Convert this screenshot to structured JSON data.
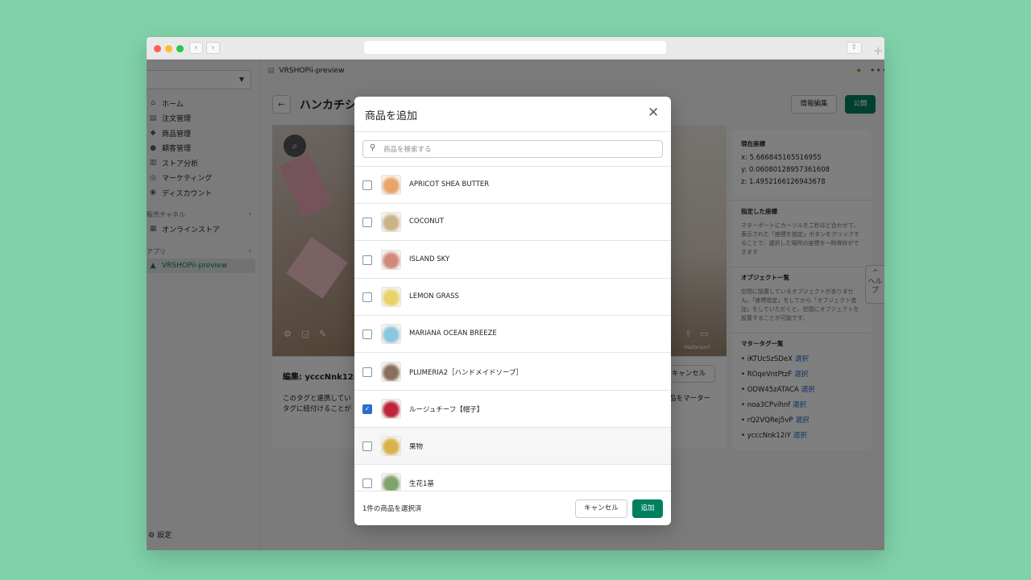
{
  "browser": {
    "back_glyph": "‹",
    "forward_glyph": "›",
    "share_glyph": "⇪",
    "new_tab_glyph": "+"
  },
  "sidebar": {
    "items": [
      {
        "label": "ホーム",
        "icon": "home-icon",
        "glyph": "⌂"
      },
      {
        "label": "注文管理",
        "icon": "orders-icon",
        "glyph": "▤"
      },
      {
        "label": "商品管理",
        "icon": "tag-icon",
        "glyph": "◆"
      },
      {
        "label": "顧客管理",
        "icon": "person-icon",
        "glyph": "●"
      },
      {
        "label": "ストア分析",
        "icon": "analytics-icon",
        "glyph": "▥"
      },
      {
        "label": "マーケティング",
        "icon": "marketing-icon",
        "glyph": "◎"
      },
      {
        "label": "ディスカウント",
        "icon": "discount-icon",
        "glyph": "◉"
      }
    ],
    "channels_label": "販売チャネル",
    "online_store": "オンラインストア",
    "apps_label": "アプリ",
    "app_item": "VRSHOPii-preview",
    "settings": "設定"
  },
  "header": {
    "app_name": "VRSHOPii-preview",
    "page_title": "ハンカチショ",
    "edit_info_button": "情報編集",
    "publish_button": "公開"
  },
  "editor": {
    "title": "編集: ycccNnk12iY",
    "desc_line1": "このタグと連携してい",
    "desc_line2": "タグに紐付けることが",
    "desc_right": "品をマーター",
    "cancel": "キャンセル",
    "viewer_brand": "Matterport"
  },
  "right_panel": {
    "current_coords_title": "現在座標",
    "x": "x: 5.666845165516955",
    "y": "y: 0.06080128957361608",
    "z": "z: 1.4952166126943678",
    "specified_title": "指定した座標",
    "specified_text": "マターポートにカーソルを二秒ほど合わせて、表示された「座標を指定」ボタンをクリックすることで、選択した場所の座標を一時保存ができます",
    "objects_title": "オブジェクト一覧",
    "objects_text": "空間に設置しているオブジェクトがありません。「座標指定」をしてから「オブジェクト追加」をしていただくと、空間にオブジェクトを設置することが可能です。",
    "tags_title": "マタータグ一覧",
    "select_label": "選択",
    "tags": [
      "iKTUcSzSDeX",
      "ROqeVntPtzF",
      "ODW45zATACA",
      "noa3CPvihnf",
      "rQ2VQRej5vP",
      "ycccNnk12iY"
    ]
  },
  "help_tab": "ヘルプ",
  "modal": {
    "title": "商品を追加",
    "search_placeholder": "商品を検索する",
    "products": [
      {
        "name": "APRICOT SHEA BUTTER",
        "checked": false,
        "thumb": "#e9a46a"
      },
      {
        "name": "COCONUT",
        "checked": false,
        "thumb": "#c9b48a"
      },
      {
        "name": "ISLAND SKY",
        "checked": false,
        "thumb": "#d08a7c"
      },
      {
        "name": "LEMON GRASS",
        "checked": false,
        "thumb": "#e8d36a"
      },
      {
        "name": "MARIANA OCEAN BREEZE",
        "checked": false,
        "thumb": "#8cc6df"
      },
      {
        "name": "PLUMERIA2［ハンドメイドソープ］",
        "checked": false,
        "thumb": "#8a6f5e"
      },
      {
        "name": "ルージュチーフ【帽子】",
        "checked": true,
        "thumb": "#c0243a"
      },
      {
        "name": "果物",
        "checked": false,
        "thumb": "#d9b24a"
      },
      {
        "name": "生花1基",
        "checked": false,
        "thumb": "#7fa36a"
      }
    ],
    "selected_count": "1件の商品を選択済",
    "cancel": "キャンセル",
    "add": "追加"
  }
}
